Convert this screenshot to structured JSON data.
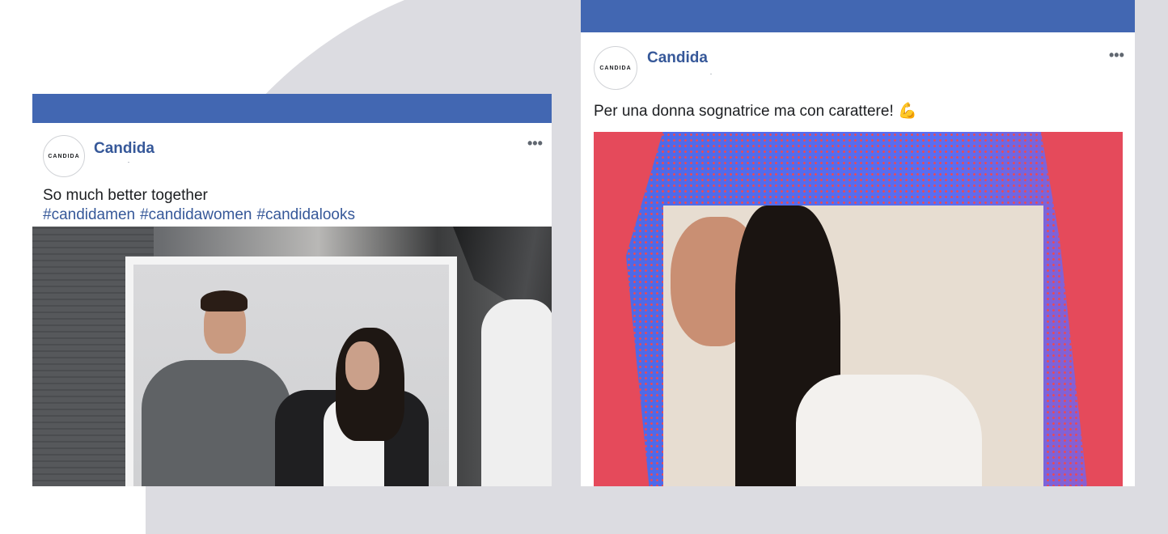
{
  "posts": [
    {
      "page_name": "Candida",
      "avatar_text": "CANDIDA",
      "more_label": "•••",
      "caption": "So much better together",
      "hashtags": [
        "#candidamen",
        "#candidawomen",
        "#candidalooks"
      ]
    },
    {
      "page_name": "Candida",
      "avatar_text": "CANDIDA",
      "more_label": "•••",
      "caption": "Per una donna sognatrice ma con carattere!",
      "emoji": "💪"
    }
  ],
  "colors": {
    "header_bar": "#4267b2",
    "page_name": "#365899",
    "background_shape": "#dcdce1"
  }
}
